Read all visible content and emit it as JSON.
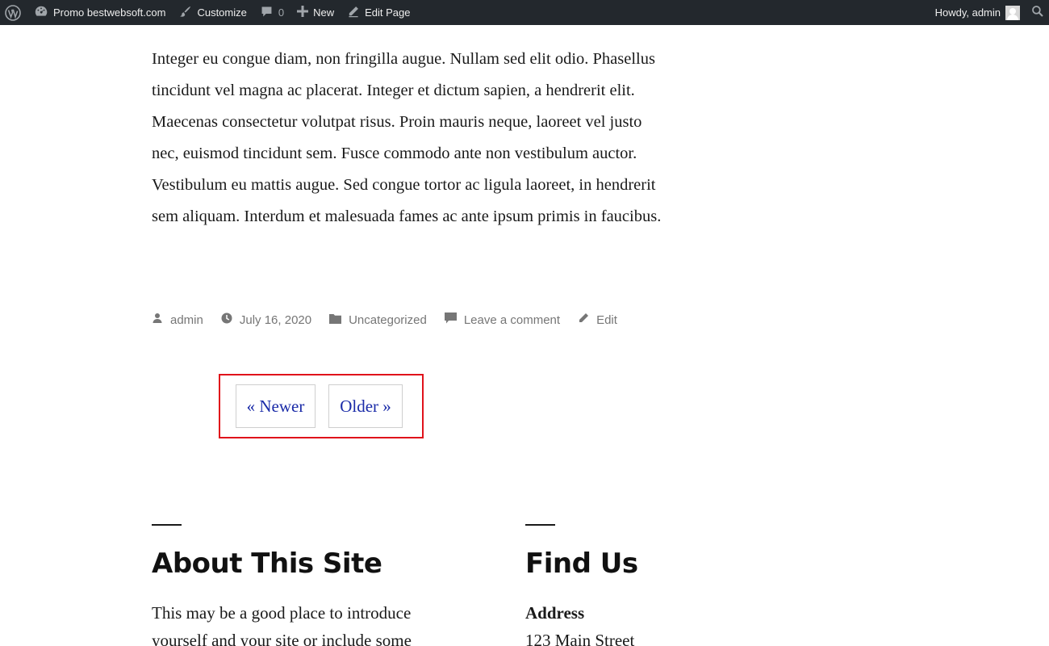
{
  "admin_bar": {
    "site_name": "Promo bestwebsoft.com",
    "customize": "Customize",
    "comments_count": "0",
    "new_label": "New",
    "edit_page": "Edit Page",
    "greeting": "Howdy, admin",
    "background": "#23282d"
  },
  "post": {
    "paragraph": "Integer eu congue diam, non fringilla augue. Nullam sed elit odio. Phasellus tincidunt vel magna ac placerat. Integer et dictum sapien, a hendrerit elit. Maecenas consectetur volutpat risus. Proin mauris neque, laoreet vel justo nec, euismod tincidunt sem. Fusce commodo ante non vestibulum auctor. Vestibulum eu mattis augue. Sed congue tortor ac ligula laoreet, in hendrerit sem aliquam. Interdum et malesuada fames ac ante ipsum primis in faucibus.",
    "meta": {
      "author": "admin",
      "date": "July 16, 2020",
      "category": "Uncategorized",
      "comments": "Leave a comment",
      "edit": "Edit"
    }
  },
  "pagination": {
    "newer": "« Newer",
    "older": "Older »",
    "highlight_color": "#e0121b",
    "link_color": "#1a2ba8"
  },
  "footer": {
    "about": {
      "title": "About This Site",
      "text": "This may be a good place to introduce yourself and your site or include some"
    },
    "find_us": {
      "title": "Find Us",
      "address_label": "Address",
      "address_line": "123 Main Street"
    }
  }
}
